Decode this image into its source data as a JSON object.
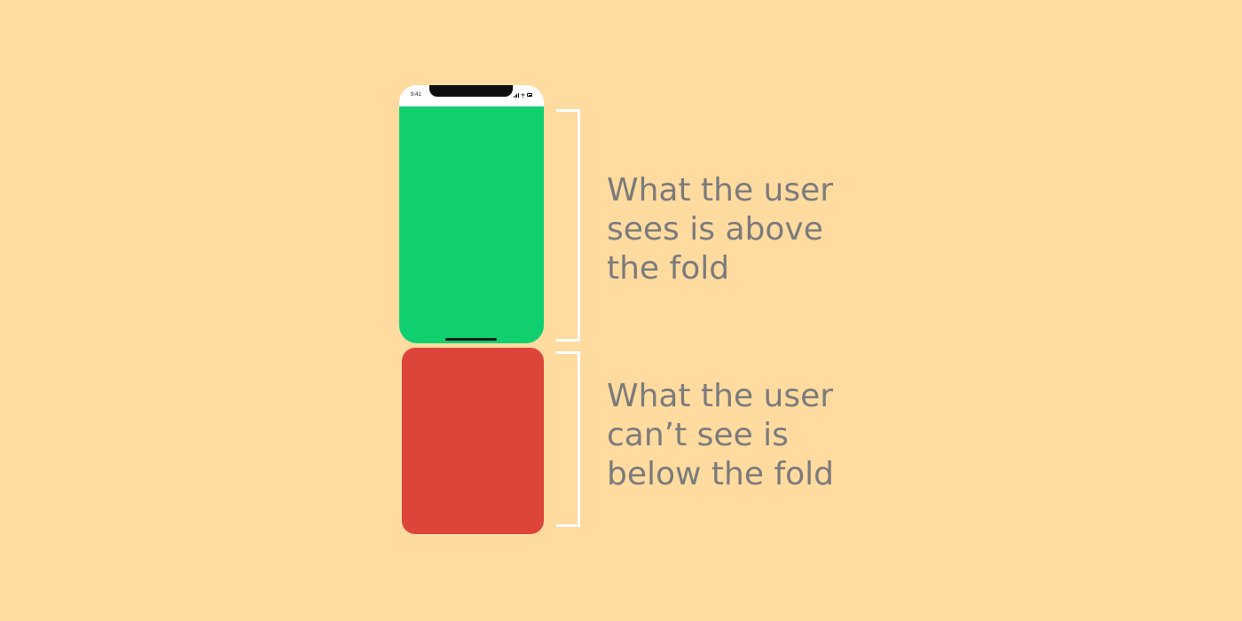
{
  "phone": {
    "status_time": "9:41",
    "icons": [
      "signal-icon",
      "wifi-icon",
      "battery-icon"
    ]
  },
  "above_fold": {
    "color": "#10CF6E",
    "label_lines": [
      "What the user",
      "sees is above",
      "the fold"
    ]
  },
  "below_fold": {
    "color": "#DE453A",
    "label_lines": [
      "What the user",
      "can’t see is",
      "below the fold"
    ]
  },
  "colors": {
    "background": "#FFDBA0",
    "text": "#7B7B7B",
    "bracket": "#FFFFFF"
  }
}
